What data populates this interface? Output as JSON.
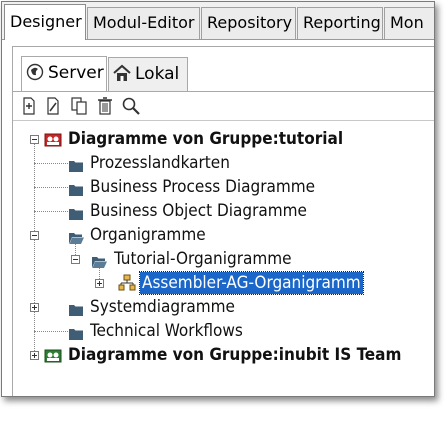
{
  "main_tabs": [
    "Designer",
    "Modul-Editor",
    "Repository",
    "Reporting",
    "Mon"
  ],
  "sub_tabs": [
    "Server",
    "Lokal"
  ],
  "toolbar": [
    "new-icon",
    "edit-icon",
    "copy-icon",
    "delete-icon",
    "search-icon"
  ],
  "tree": {
    "root_label": "Diagramme von Gruppe:tutorial",
    "items": [
      "Prozesslandkarten",
      "Business Process Diagramme",
      "Business Object Diagramme",
      "Organigramme",
      "Tutorial-Organigramme",
      "Assembler-AG-Organigramm",
      "Systemdiagramme",
      "Technical Workflows"
    ],
    "second_root_label": "Diagramme von Gruppe:inubit IS Team"
  },
  "colors": {
    "selection": "#1a67c9",
    "folder": "#3f5d74",
    "root_icon": "#b22222"
  }
}
